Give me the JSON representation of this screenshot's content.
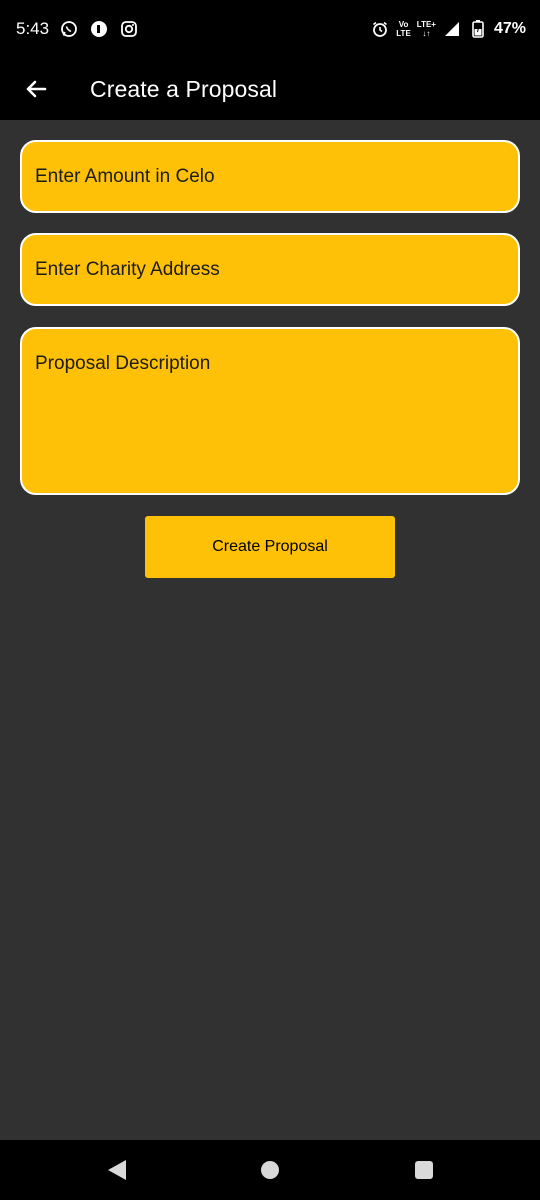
{
  "status_bar": {
    "time": "5:43",
    "icons_left": [
      "whatsapp-icon",
      "app-icon",
      "instagram-icon"
    ],
    "alarm": "alarm-icon",
    "volte_top": "Vo",
    "volte_bottom": "LTE",
    "lte_top": "LTE+",
    "lte_bottom": "↓↑",
    "battery_percent": "47%"
  },
  "app_bar": {
    "title": "Create a Proposal"
  },
  "form": {
    "amount_placeholder": "Enter Amount in Celo",
    "address_placeholder": "Enter Charity Address",
    "description_placeholder": "Proposal Description",
    "submit_label": "Create Proposal"
  },
  "colors": {
    "accent": "#ffc107",
    "background": "#313131",
    "bar": "#000000"
  }
}
